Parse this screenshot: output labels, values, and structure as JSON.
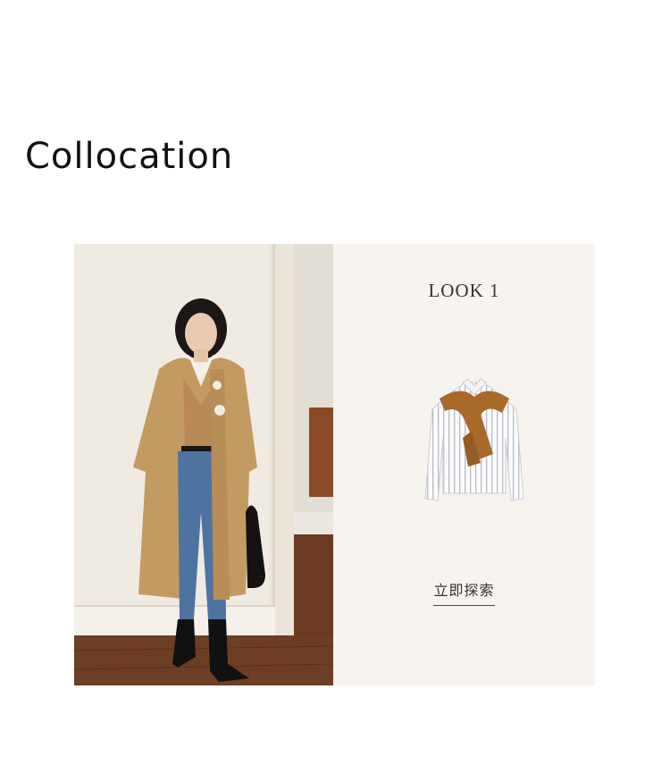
{
  "section": {
    "title": "Collocation"
  },
  "look": {
    "label": "LOOK 1",
    "cta_label": "立即探索"
  },
  "colors": {
    "panel_bg": "#f7f3ef",
    "coat": "#c49a63",
    "jeans": "#4e73a0",
    "scarf": "#a8692a"
  }
}
